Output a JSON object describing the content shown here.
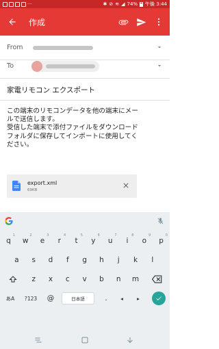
{
  "status_bar": {
    "notification_icons": [
      "mail-icon",
      "gmail-icon",
      "chat-icon",
      "photo-icon"
    ],
    "more": "···",
    "battery": "74%",
    "time": "午後 3:44"
  },
  "app_bar": {
    "title": "作成",
    "back_icon": "arrow-left-icon",
    "attach_icon": "paperclip-icon",
    "send_icon": "send-icon",
    "menu_icon": "more-vert-icon",
    "color": "#e53935"
  },
  "compose": {
    "from_label": "From",
    "to_label": "To",
    "subject": "家電リモコン エクスポート",
    "body_lines": [
      "この端末のリモコンデータを他の端末にメー",
      "ルで送信します。",
      "受信した端末で添付ファイルをダウンロード",
      "フォルダに保存してインポートに使用してく",
      "ださい。"
    ]
  },
  "attachment": {
    "name": "export.xml",
    "size": "69KB",
    "icon": "document-icon",
    "icon_color": "#4285f4"
  },
  "keyboard": {
    "row1": [
      {
        "k": "q",
        "h": "1"
      },
      {
        "k": "w",
        "h": "2"
      },
      {
        "k": "e",
        "h": "3"
      },
      {
        "k": "r",
        "h": "4"
      },
      {
        "k": "t",
        "h": "5"
      },
      {
        "k": "y",
        "h": "6"
      },
      {
        "k": "u",
        "h": "7"
      },
      {
        "k": "i",
        "h": "8"
      },
      {
        "k": "o",
        "h": "9"
      },
      {
        "k": "p",
        "h": "0"
      }
    ],
    "row2": [
      "a",
      "s",
      "d",
      "f",
      "g",
      "h",
      "j",
      "k",
      "l"
    ],
    "row3": [
      "z",
      "x",
      "c",
      "v",
      "b",
      "n",
      "m"
    ],
    "row4": {
      "lang": "あA",
      "numbers": "?123",
      "at": "@",
      "space": "日本語",
      "dot": ".",
      "left": "◂",
      "right": "▸"
    },
    "accent": "#26a69a"
  }
}
